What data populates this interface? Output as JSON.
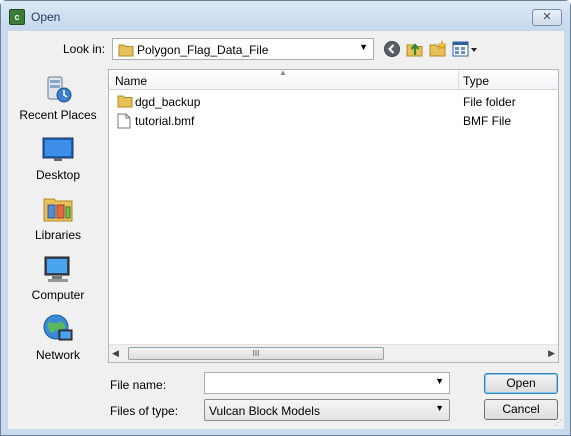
{
  "window": {
    "title": "Open",
    "close_glyph": "✕"
  },
  "look_in": {
    "label": "Look in:",
    "value": "Polygon_Flag_Data_File"
  },
  "toolbar": {
    "icons": [
      "back-icon",
      "up-folder-icon",
      "new-folder-icon",
      "view-menu-icon"
    ]
  },
  "places": [
    {
      "label": "Recent Places",
      "icon": "recent-places-icon"
    },
    {
      "label": "Desktop",
      "icon": "desktop-icon"
    },
    {
      "label": "Libraries",
      "icon": "libraries-icon"
    },
    {
      "label": "Computer",
      "icon": "computer-icon"
    },
    {
      "label": "Network",
      "icon": "network-icon"
    }
  ],
  "file_list": {
    "columns": {
      "name": "Name",
      "type": "Type"
    },
    "rows": [
      {
        "name": "dgd_backup",
        "type": "File folder",
        "icon": "folder-icon"
      },
      {
        "name": "tutorial.bmf",
        "type": "BMF File",
        "icon": "file-icon"
      }
    ],
    "scroll_thumb_glyph": "III"
  },
  "file_name": {
    "label": "File name:",
    "value": ""
  },
  "files_of_type": {
    "label": "Files of type:",
    "value": "Vulcan Block Models"
  },
  "buttons": {
    "open": "Open",
    "cancel": "Cancel"
  },
  "colors": {
    "title_text": "#1e395b",
    "frame": "#c9daec",
    "folder": "#e8c15a"
  }
}
